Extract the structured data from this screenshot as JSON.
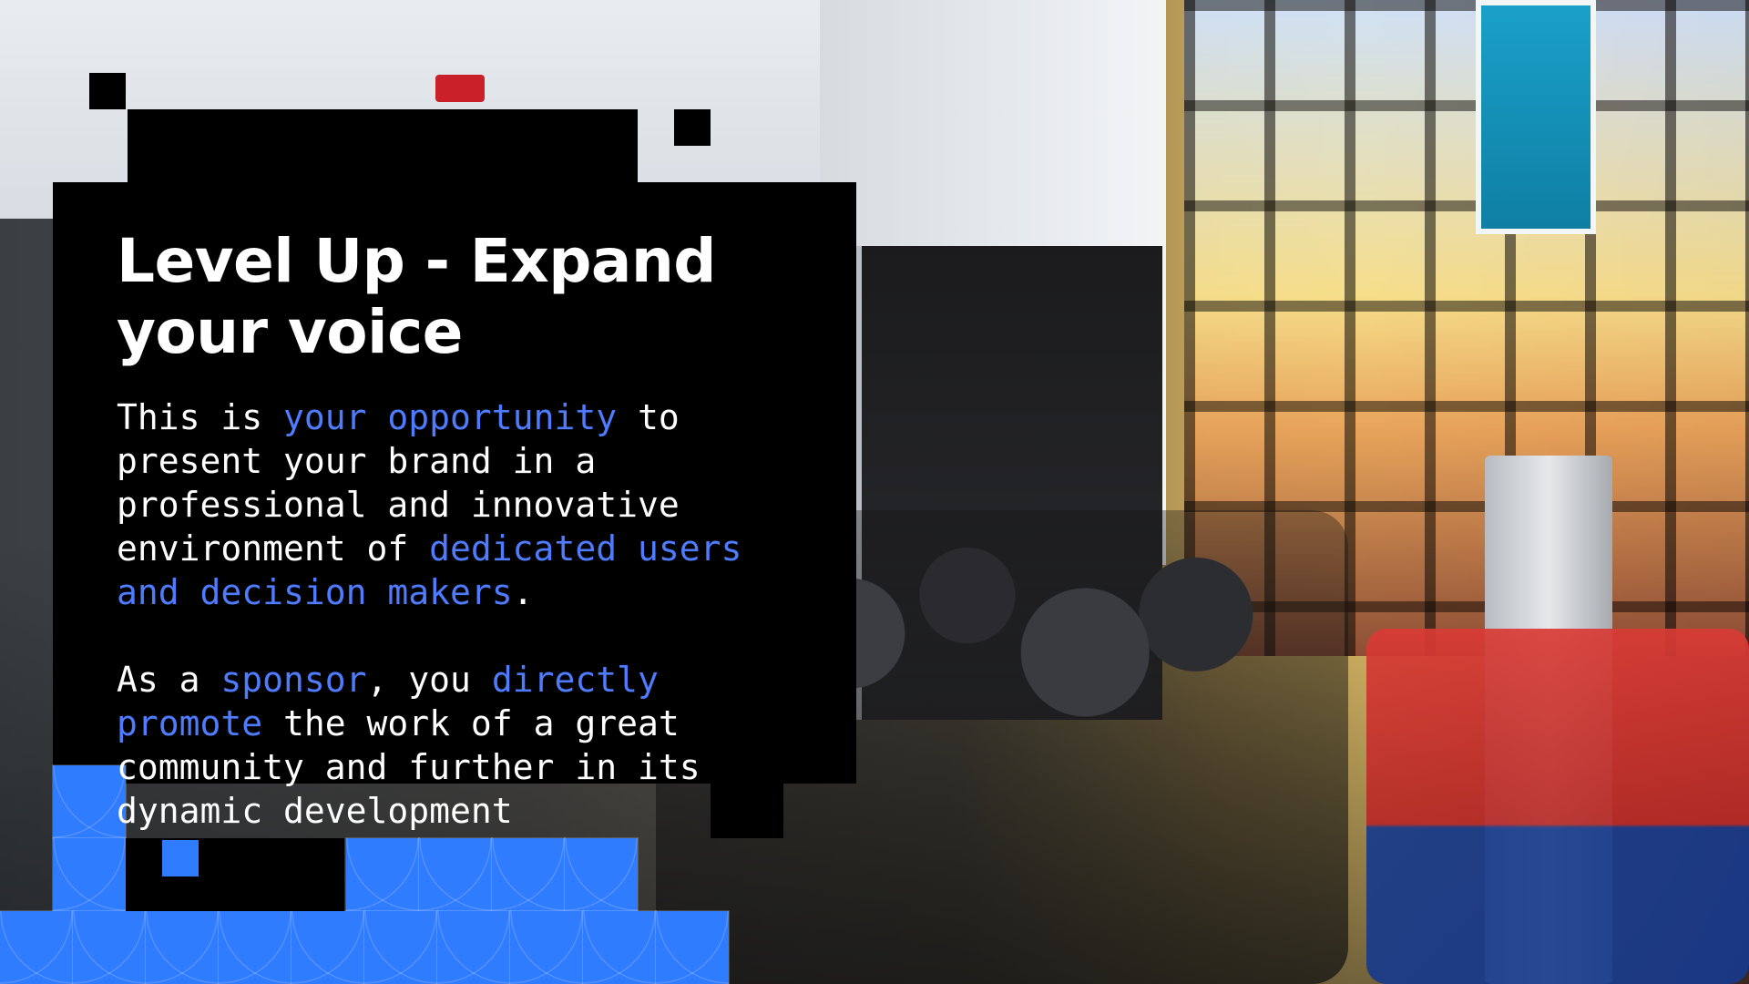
{
  "slide": {
    "title": "Level Up - Expand your voice",
    "paragraph1": {
      "t1": "This is ",
      "hl1": "your opportunity",
      "t2": " to present your brand in a professional and innovative environment of ",
      "hl2": "dedicated users and decision makers",
      "t3": "."
    },
    "paragraph2": {
      "t1": "As a ",
      "hl1": "sponsor",
      "t2": ", you ",
      "hl2": "directly promote",
      "t3": " the work of a great community and further in its dynamic development"
    }
  },
  "colors": {
    "highlight": "#4f7cff",
    "panel": "#000000",
    "pattern_blue": "#2f7cff"
  },
  "icons": [
    "exit-sign-icon"
  ]
}
